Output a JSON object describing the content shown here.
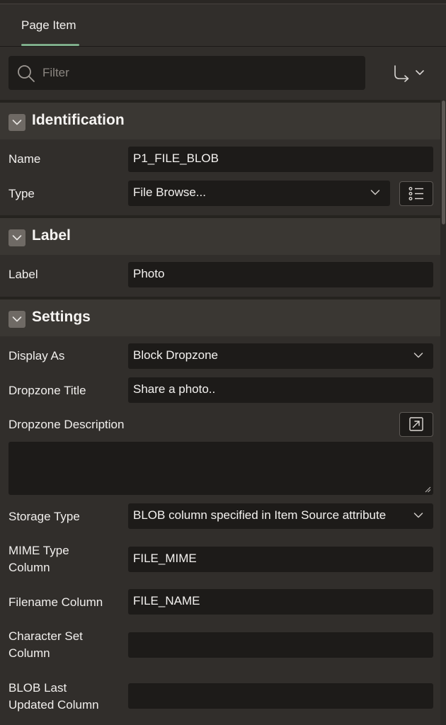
{
  "tabs": [
    {
      "label": "Page Item",
      "active": true
    }
  ],
  "filter": {
    "placeholder": "Filter",
    "value": ""
  },
  "icons": {
    "search": "search-icon",
    "goto": "go-to-group-icon",
    "toggle": "chevron-down-icon",
    "list": "list-of-values-icon",
    "expand": "open-in-editor-icon",
    "resize": "resize-handle-icon"
  },
  "colors": {
    "background": "#312e2b",
    "field": "#1d1b19",
    "section_header": "#3a3733",
    "accent": "#7fae8b"
  },
  "sections": {
    "identification": {
      "title": "Identification",
      "name_label": "Name",
      "name_value": "P1_FILE_BLOB",
      "type_label": "Type",
      "type_value": "File Browse..."
    },
    "label": {
      "title": "Label",
      "label_label": "Label",
      "label_value": "Photo"
    },
    "settings": {
      "title": "Settings",
      "display_as_label": "Display As",
      "display_as_value": "Block Dropzone",
      "dropzone_title_label": "Dropzone Title",
      "dropzone_title_value": "Share a photo..",
      "dropzone_description_label": "Dropzone Description",
      "dropzone_description_value": "",
      "storage_type_label": "Storage Type",
      "storage_type_value": "BLOB column specified in Item Source attribute",
      "mime_type_label_1": "MIME Type",
      "mime_type_label_2": "Column",
      "mime_type_value": "FILE_MIME",
      "filename_label": "Filename Column",
      "filename_value": "FILE_NAME",
      "charset_label_1": "Character Set",
      "charset_label_2": "Column",
      "charset_value": "",
      "blob_last_label_1": "BLOB Last",
      "blob_last_label_2": "Updated Column",
      "blob_last_value": ""
    }
  }
}
